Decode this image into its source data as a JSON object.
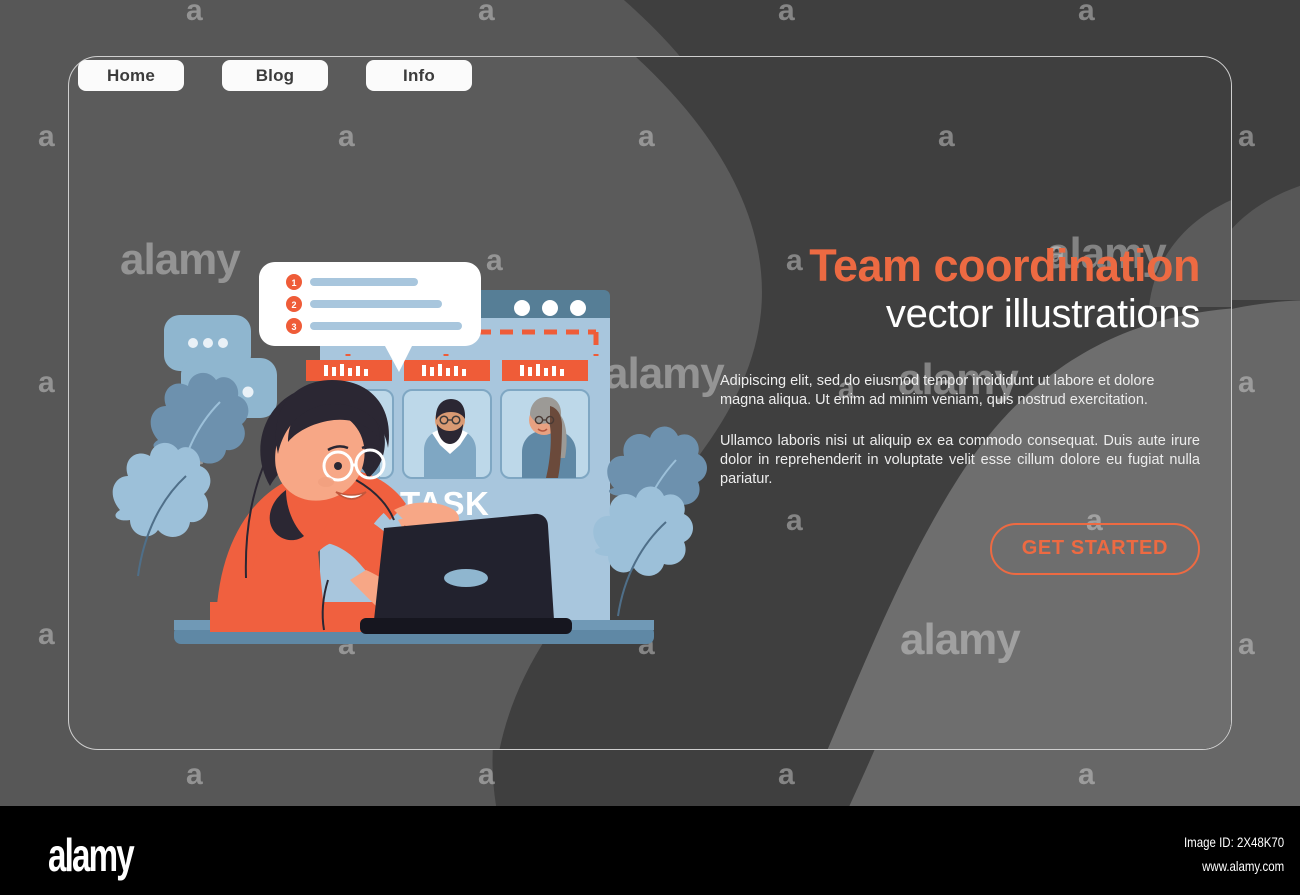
{
  "page": {
    "background_color": "#575757",
    "panel_color": "#5b5b5b",
    "panel_border_color": "#cfcfcf",
    "accent_color": "#ed6a42",
    "blob_dark_color": "#3f3f3f",
    "blob_light_color": "#6e6e6e"
  },
  "nav": {
    "items": [
      {
        "label": "Home",
        "name": "home"
      },
      {
        "label": "Blog",
        "name": "blog"
      },
      {
        "label": "Info",
        "name": "info"
      }
    ]
  },
  "hero": {
    "headline": "Team coordination",
    "subhead": "vector illustrations",
    "paragraph1": "Adipiscing elit, sed do eiusmod tempor incididunt ut labore et dolore magna aliqua. Ut enim ad minim veniam, quis nostrud exercitation.",
    "paragraph2": "Ullamco laboris nisi ut aliquip ex ea commodo consequat. Duis aute irure dolor in reprehenderit in voluptate velit esse cillum dolore eu fugiat nulla pariatur.",
    "cta_label": "GET STARTED"
  },
  "illustration": {
    "board_label": "TASK",
    "checklist_numbers": [
      "1",
      "2",
      "3"
    ],
    "window_dots": 3,
    "avatar_count": 3,
    "typing_bubbles": 2,
    "colors": {
      "board": "#a8c6dd",
      "board_header": "#567e96",
      "sweater": "#f0603f",
      "skin": "#f7a786",
      "hair": "#2b2733",
      "leaf_dark": "#6d91ae",
      "leaf_light": "#9cc0d9",
      "laptop": "#22222e",
      "desk": "#5f88a5",
      "bubble": "#8fb6cf",
      "card": "#bdd8e9",
      "tag": "#ef5c38"
    }
  },
  "watermarks": {
    "letter": "a",
    "word": "alamy",
    "footer_logo": "alamy",
    "image_id": "Image ID: 2X48K70",
    "url": "www.alamy.com"
  }
}
